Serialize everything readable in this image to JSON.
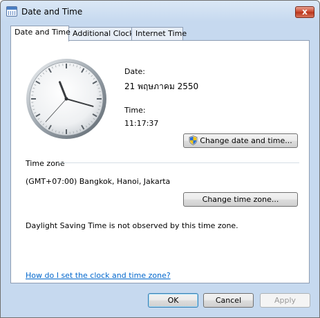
{
  "window": {
    "title": "Date and Time",
    "close_label": "x"
  },
  "tabs": [
    {
      "label": "Date and Time",
      "active": true
    },
    {
      "label": "Additional Clocks",
      "active": false
    },
    {
      "label": "Internet Time",
      "active": false
    }
  ],
  "date": {
    "label": "Date:",
    "value": "21 พฤษภาคม 2550"
  },
  "time": {
    "label": "Time:",
    "value": "11:17:37"
  },
  "buttons": {
    "change_date_time": "Change date and time...",
    "change_time_zone": "Change time zone...",
    "ok": "OK",
    "cancel": "Cancel",
    "apply": "Apply"
  },
  "timezone": {
    "section_label": "Time zone",
    "value": "(GMT+07:00) Bangkok, Hanoi, Jakarta",
    "dst_note": "Daylight Saving Time is not observed by this time zone."
  },
  "help_link": "How do I set the clock and time zone?",
  "icons": {
    "window_icon": "calendar-clock-icon",
    "uac": "uac-shield-icon"
  },
  "clock": {
    "hours": 11,
    "minutes": 17,
    "seconds": 37
  }
}
